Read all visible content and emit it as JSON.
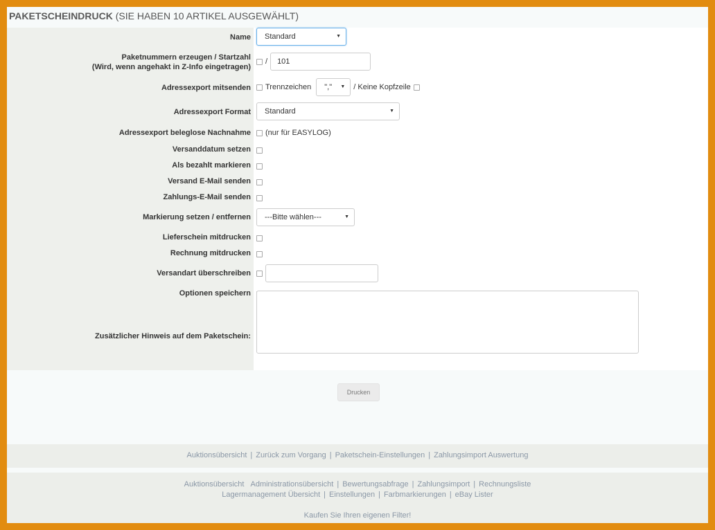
{
  "header": {
    "title": "PAKETSCHEINDRUCK",
    "subtitle": "(SIE HABEN 10 ARTIKEL AUSGEWÄHLT)"
  },
  "form": {
    "name_label": "Name",
    "name_value": "Standard",
    "paketnummern_label_1": "Paketnummern erzeugen / Startzahl",
    "paketnummern_label_2": "(Wird, wenn angehakt in Z-Info eingetragen)",
    "paketnummern_slash": "/",
    "startzahl_value": "101",
    "adressexport_label": "Adressexport mitsenden",
    "trennzeichen_label": "Trennzeichen",
    "trennzeichen_value": "\",\"",
    "keine_kopfzeile_label": "/ Keine Kopfzeile",
    "adressexport_format_label": "Adressexport Format",
    "adressexport_format_value": "Standard",
    "nachnahme_label": "Adressexport beleglose Nachnahme",
    "nachnahme_hint": "(nur für EASYLOG)",
    "versanddatum_label": "Versanddatum setzen",
    "bezahlt_label": "Als bezahlt markieren",
    "versand_email_label": "Versand E-Mail senden",
    "zahlungs_email_label": "Zahlungs-E-Mail senden",
    "markierung_label": "Markierung setzen / entfernen",
    "markierung_value": "---Bitte wählen---",
    "lieferschein_label": "Lieferschein mitdrucken",
    "rechnung_label": "Rechnung mitdrucken",
    "versandart_label": "Versandart überschreiben",
    "versandart_value": "",
    "optionen_label": "Optionen speichern",
    "hinweis_label": "Zusätzlicher Hinweis auf dem Paketschein:",
    "print_button": "Drucken"
  },
  "nav1": [
    "Auktionsübersicht",
    "Zurück zum Vorgang",
    "Paketschein-Einstellungen",
    "Zahlungsimport Auswertung"
  ],
  "footer": {
    "row1": [
      "Auktionsübersicht",
      "Administrationsübersicht",
      "Bewertungsabfrage",
      "Zahlungsimport",
      "Rechnungsliste"
    ],
    "row2": [
      "Lagermanagement Übersicht",
      "Einstellungen",
      "Farbmarkierungen",
      "eBay Lister"
    ],
    "tagline": "Kaufen Sie Ihren eigenen Filter!"
  },
  "colors": {
    "outer_border": "#e28c10",
    "label_bg": "#eef0ec",
    "link": "#8a97a6"
  }
}
